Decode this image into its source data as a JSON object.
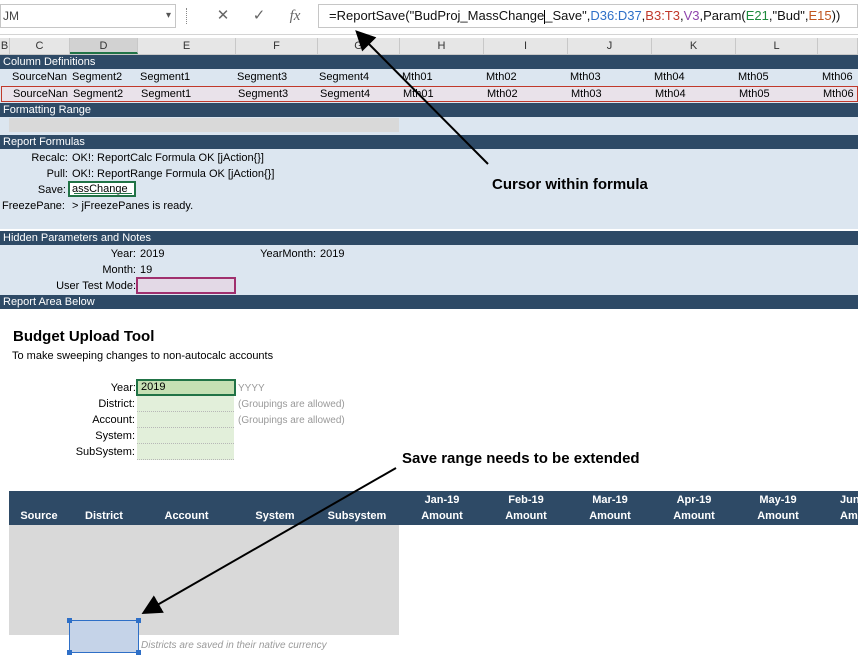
{
  "formula_bar": {
    "name_box": "JM",
    "cancel_icon": "✕",
    "enter_icon": "✓",
    "fx_icon": "fx",
    "formula_parts": [
      "=ReportSave(\"BudProj_MassChange",
      "_Save\",",
      "D36:D37",
      ",",
      "B3:T3",
      ",",
      "V3",
      ",Param(",
      "E21",
      ",\"Bud\",",
      "E15",
      "))"
    ]
  },
  "columns": [
    "B",
    "C",
    "D",
    "E",
    "F",
    "G",
    "H",
    "I",
    "J",
    "K",
    "L"
  ],
  "sections": {
    "column_definitions": "Column Definitions",
    "formatting_range": "Formatting Range",
    "report_formulas": "Report Formulas",
    "hidden_parameters": "Hidden Parameters and Notes",
    "report_area": "Report Area Below"
  },
  "column_def_rows": [
    [
      "SourceNan",
      "Segment2",
      "Segment1",
      "Segment3",
      "Segment4",
      "Mth01",
      "Mth02",
      "Mth03",
      "Mth04",
      "Mth05",
      "Mth06"
    ],
    [
      "SourceNan",
      "Segment2",
      "Segment1",
      "Segment3",
      "Segment4",
      "Mth01",
      "Mth02",
      "Mth03",
      "Mth04",
      "Mth05",
      "Mth06"
    ]
  ],
  "report_formulas": {
    "recalc_label": "Recalc:",
    "recalc_value": "OK!: ReportCalc Formula OK [jAction{}]",
    "pull_label": "Pull:",
    "pull_value": "OK!: ReportRange Formula OK [jAction{}]",
    "save_label": "Save:",
    "save_value": "assChange",
    "freeze_label": "FreezePane:",
    "freeze_value": "> jFreezePanes is ready."
  },
  "hidden_params": {
    "year_label": "Year:",
    "year_value": "2019",
    "yearmonth_label": "YearMonth:",
    "yearmonth_value": "2019",
    "month_label": "Month:",
    "month_value": "19",
    "user_test_label": "User Test Mode:"
  },
  "tool": {
    "title": "Budget Upload Tool",
    "subtitle": "To make sweeping changes to non-autocalc accounts",
    "year_label": "Year:",
    "year_value": "2019",
    "year_hint": "YYYY",
    "district_label": "District:",
    "district_hint": "(Groupings are allowed)",
    "account_label": "Account:",
    "account_hint": "(Groupings are allowed)",
    "system_label": "System:",
    "subsystem_label": "SubSystem:"
  },
  "table_headers": {
    "source": "Source",
    "district": "District",
    "account": "Account",
    "system": "System",
    "subsystem": "Subsystem",
    "months": [
      {
        "month": "Jan-19",
        "sub": "Amount"
      },
      {
        "month": "Feb-19",
        "sub": "Amount"
      },
      {
        "month": "Mar-19",
        "sub": "Amount"
      },
      {
        "month": "Apr-19",
        "sub": "Amount"
      },
      {
        "month": "May-19",
        "sub": "Amount"
      },
      {
        "month": "Jun",
        "sub": "Am"
      }
    ]
  },
  "footer_hint": "Districts are saved in their native currency",
  "annotations": {
    "cursor": "Cursor within formula",
    "save_range": "Save range needs to be extended"
  },
  "colors": {
    "band_dark": "#2e4a66",
    "band_light": "#dce6f0",
    "selection_green": "#217346",
    "highlight_red": "#c0392b",
    "highlight_purple": "#a0306e"
  }
}
